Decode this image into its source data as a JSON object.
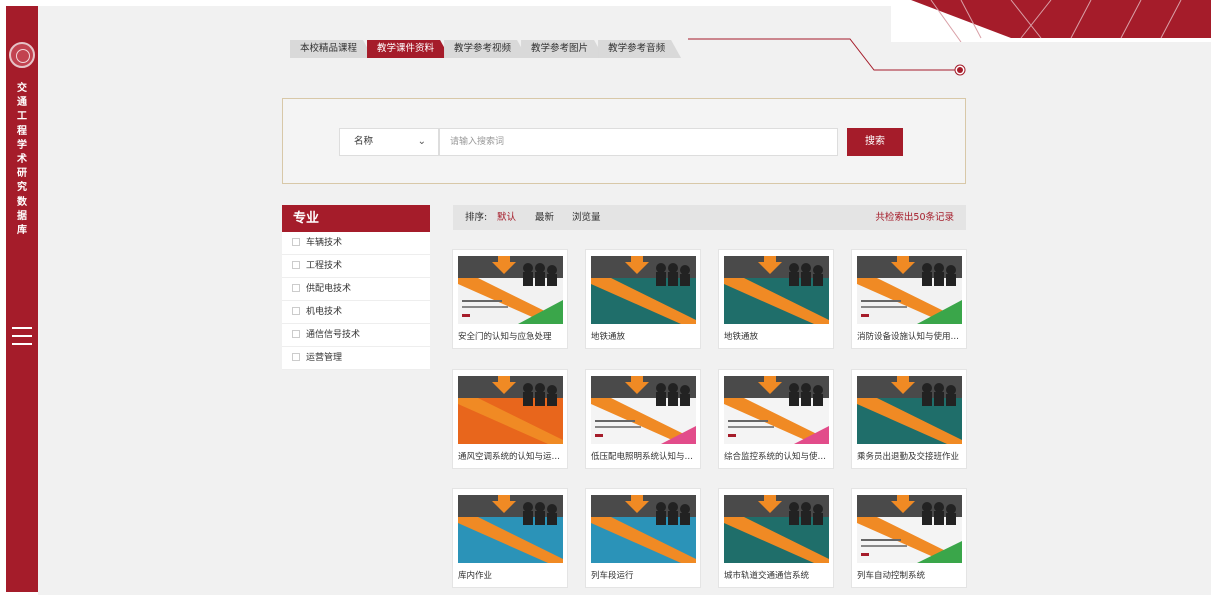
{
  "sidebar": {
    "title_chars": [
      "交",
      "通",
      "工",
      "程",
      "学",
      "术",
      "研",
      "究",
      "数",
      "据",
      "库"
    ],
    "menu_icon": "hamburger-icon",
    "logo_icon": "university-seal-icon"
  },
  "tabs": [
    {
      "label": "本校精品课程",
      "active": false
    },
    {
      "label": "教学课件资料",
      "active": true
    },
    {
      "label": "教学参考视频",
      "active": false
    },
    {
      "label": "教学参考图片",
      "active": false
    },
    {
      "label": "教学参考音频",
      "active": false
    }
  ],
  "search": {
    "field_select": "名称",
    "placeholder": "请输入搜索词",
    "button_label": "搜索"
  },
  "category": {
    "heading": "专业",
    "items": [
      "车辆技术",
      "工程技术",
      "供配电技术",
      "机电技术",
      "通信信号技术",
      "运营管理"
    ]
  },
  "sort": {
    "label": "排序:",
    "options": [
      "默认",
      "最新",
      "浏览量"
    ],
    "active": "默认",
    "total_text": "共检索出50条记录"
  },
  "cards": [
    {
      "title": "安全门的认知与应急处理",
      "style": "white"
    },
    {
      "title": "地铁通放",
      "style": "teal"
    },
    {
      "title": "地铁通放",
      "style": "teal"
    },
    {
      "title": "消防设备设施认知与使用操...",
      "style": "white"
    },
    {
      "title": "通风空调系统的认知与运行...",
      "style": "orange"
    },
    {
      "title": "低压配电照明系统认知与运...",
      "style": "white-pink"
    },
    {
      "title": "综合监控系统的认知与使用...",
      "style": "white-pink"
    },
    {
      "title": "乘务员出退勤及交接班作业",
      "style": "teal"
    },
    {
      "title": "库内作业",
      "style": "blue"
    },
    {
      "title": "列车段运行",
      "style": "blue"
    },
    {
      "title": "城市轨道交通通信系统",
      "style": "teal"
    },
    {
      "title": "列车自动控制系统",
      "style": "white-green"
    }
  ],
  "colors": {
    "brand": "#a51c2a",
    "background": "#f1f1f1"
  }
}
